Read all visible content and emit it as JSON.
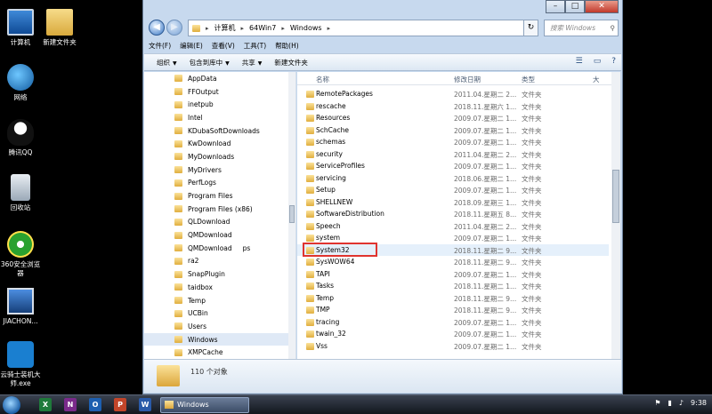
{
  "desktop": {
    "icons": [
      {
        "label": "计算机",
        "icon": "computer-icon"
      },
      {
        "label": "新建文件夹",
        "icon": "folder-icon"
      },
      {
        "label": "网络",
        "icon": "network-icon"
      },
      {
        "label": "腾讯QQ",
        "icon": "qq-icon"
      },
      {
        "label": "回收站",
        "icon": "recycle-bin-icon"
      },
      {
        "label": "360安全浏览器",
        "icon": "browser360-icon"
      },
      {
        "label": "JIACHON...",
        "icon": "computer-icon"
      },
      {
        "label": "云骑士装机大师.exe",
        "icon": "app-icon"
      }
    ]
  },
  "window": {
    "breadcrumb": [
      "计算机",
      "64Win7",
      "Windows"
    ],
    "search_placeholder": "搜索 Windows",
    "menu": [
      "文件(F)",
      "编辑(E)",
      "查看(V)",
      "工具(T)",
      "帮助(H)"
    ],
    "toolbar": [
      "组织",
      "包含到库中",
      "共享",
      "新建文件夹"
    ]
  },
  "tree": [
    "AppData",
    "FFOutput",
    "inetpub",
    "Intel",
    "KDubaSoftDownloads",
    "KwDownload",
    "MyDownloads",
    "MyDrivers",
    "PerfLogs",
    "Program Files",
    "Program Files (x86)",
    "QLDownload",
    "QMDownload",
    "QMDownload",
    "ra2",
    "SnapPlugin",
    "taidbox",
    "Temp",
    "UCBin",
    "Users",
    "Windows",
    "XMPCache"
  ],
  "tree_extra": "ps",
  "columns": {
    "name": "名称",
    "date": "修改日期",
    "type": "类型",
    "size": "大"
  },
  "files": [
    {
      "name": "RemotePackages",
      "date": "2011.04.星期二 2...",
      "type": "文件夹"
    },
    {
      "name": "rescache",
      "date": "2018.11.星期六 1...",
      "type": "文件夹"
    },
    {
      "name": "Resources",
      "date": "2009.07.星期二 1...",
      "type": "文件夹"
    },
    {
      "name": "SchCache",
      "date": "2009.07.星期二 1...",
      "type": "文件夹"
    },
    {
      "name": "schemas",
      "date": "2009.07.星期二 1...",
      "type": "文件夹"
    },
    {
      "name": "security",
      "date": "2011.04.星期二 2...",
      "type": "文件夹"
    },
    {
      "name": "ServiceProfiles",
      "date": "2009.07.星期二 1...",
      "type": "文件夹"
    },
    {
      "name": "servicing",
      "date": "2018.06.星期二 1...",
      "type": "文件夹"
    },
    {
      "name": "Setup",
      "date": "2009.07.星期二 1...",
      "type": "文件夹"
    },
    {
      "name": "SHELLNEW",
      "date": "2018.09.星期三 1...",
      "type": "文件夹"
    },
    {
      "name": "SoftwareDistribution",
      "date": "2018.11.星期五 8...",
      "type": "文件夹"
    },
    {
      "name": "Speech",
      "date": "2011.04.星期二 2...",
      "type": "文件夹"
    },
    {
      "name": "system",
      "date": "2009.07.星期二 1...",
      "type": "文件夹"
    },
    {
      "name": "System32",
      "date": "2018.11.星期二 9...",
      "type": "文件夹"
    },
    {
      "name": "SysWOW64",
      "date": "2018.11.星期二 9...",
      "type": "文件夹"
    },
    {
      "name": "TAPI",
      "date": "2009.07.星期二 1...",
      "type": "文件夹"
    },
    {
      "name": "Tasks",
      "date": "2018.11.星期二 1...",
      "type": "文件夹"
    },
    {
      "name": "Temp",
      "date": "2018.11.星期二 9...",
      "type": "文件夹"
    },
    {
      "name": "TMP",
      "date": "2018.11.星期二 9...",
      "type": "文件夹"
    },
    {
      "name": "tracing",
      "date": "2009.07.星期二 1...",
      "type": "文件夹"
    },
    {
      "name": "twain_32",
      "date": "2009.07.星期二 1...",
      "type": "文件夹"
    },
    {
      "name": "Vss",
      "date": "2009.07.星期二 1...",
      "type": "文件夹"
    }
  ],
  "status": {
    "count": "110 个对象"
  },
  "taskbar": {
    "window_label": "Windows",
    "time": "9:38"
  }
}
